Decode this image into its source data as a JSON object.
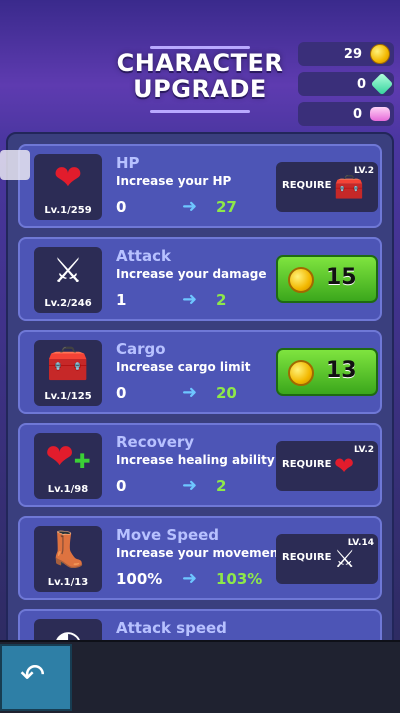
{
  "header": {
    "title_line1": "CHARACTER",
    "title_line2": "UPGRADE"
  },
  "currencies": [
    {
      "value": "29",
      "icon": "gold-coin-icon"
    },
    {
      "value": "0",
      "icon": "green-gem-icon"
    },
    {
      "value": "0",
      "icon": "pink-gem-icon"
    }
  ],
  "upgrades": [
    {
      "name": "HP",
      "description": "Increase your HP",
      "level": "Lv.1/259",
      "from": "0",
      "to": "27",
      "icon": "heart-icon",
      "action": {
        "type": "require",
        "label": "REQUIRE",
        "req_level": "LV.2",
        "req_icon": "chest-icon"
      }
    },
    {
      "name": "Attack",
      "description": "Increase your damage",
      "level": "Lv.2/246",
      "from": "1",
      "to": "2",
      "icon": "crossed-swords-icon",
      "action": {
        "type": "buy",
        "price": "15"
      }
    },
    {
      "name": "Cargo",
      "description": "Increase cargo limit",
      "level": "Lv.1/125",
      "from": "0",
      "to": "20",
      "icon": "chest-icon",
      "action": {
        "type": "buy",
        "price": "13"
      }
    },
    {
      "name": "Recovery",
      "description": "Increase healing ability",
      "level": "Lv.1/98",
      "from": "0",
      "to": "2",
      "icon": "heart-plus-icon",
      "action": {
        "type": "require",
        "label": "REQUIRE",
        "req_level": "LV.2",
        "req_icon": "heart-icon"
      }
    },
    {
      "name": "Move Speed",
      "description": "Increase your movement",
      "level": "Lv.1/13",
      "from": "100%",
      "to": "103%",
      "icon": "winged-boot-icon",
      "action": {
        "type": "require",
        "label": "REQUIRE",
        "req_level": "LV.14",
        "req_icon": "crossed-swords-icon"
      }
    },
    {
      "name": "Attack speed",
      "icon": "attack-speed-icon"
    }
  ],
  "footer": {
    "back_icon": "back-arrow-icon"
  }
}
